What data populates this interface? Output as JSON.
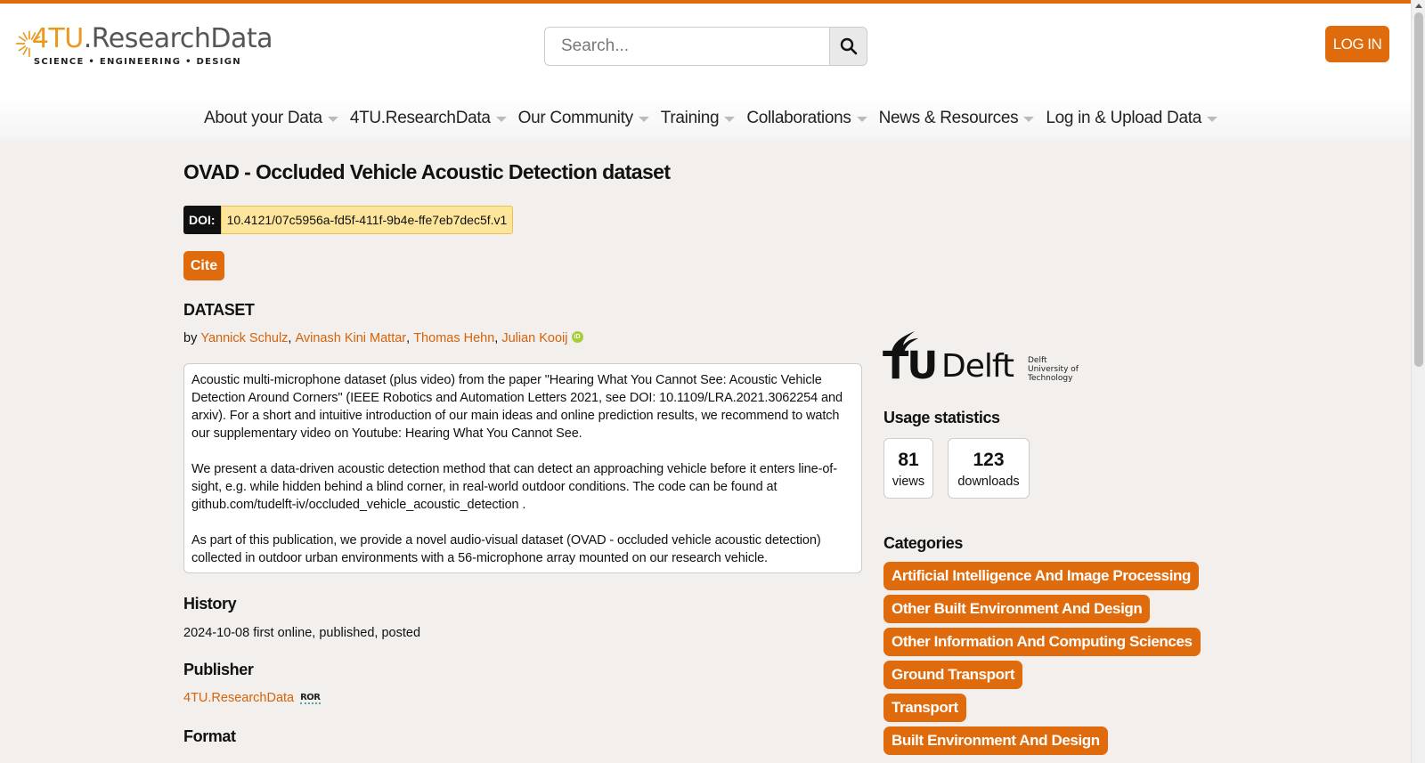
{
  "header": {
    "logo": {
      "main_prefix": "4TU",
      "main_suffix": ".ResearchData",
      "sub": "SCIENCE • ENGINEERING • DESIGN"
    },
    "search": {
      "placeholder": "Search..."
    },
    "login_label": "LOG IN",
    "accent_color": "#e06b0c"
  },
  "nav": {
    "items": [
      {
        "label": "About your Data"
      },
      {
        "label": "4TU.ResearchData"
      },
      {
        "label": "Our Community"
      },
      {
        "label": "Training"
      },
      {
        "label": "Collaborations"
      },
      {
        "label": "News & Resources"
      },
      {
        "label": "Log in & Upload Data"
      }
    ]
  },
  "dataset": {
    "title": "OVAD - Occluded Vehicle Acoustic Detection dataset",
    "doi_label": "DOI:",
    "doi": "10.4121/07c5956a-fd5f-411f-9b4e-ffe7eb7dec5f.v1",
    "cite_label": "Cite",
    "type_label": "DATASET",
    "by": "by",
    "authors": [
      "Yannick Schulz",
      "Avinash Kini Mattar",
      "Thomas Hehn",
      "Julian Kooij"
    ],
    "orcid_icon": "iD",
    "description": [
      "Acoustic multi-microphone dataset (plus video) from the paper \"Hearing What You Cannot See: Acoustic Vehicle Detection Around Corners\" (IEEE Robotics and Automation Letters 2021, see DOI: 10.1109/LRA.2021.3062254 and arxiv). For a short and intuitive introduction of our main ideas and online prediction results, we recommend to watch our supplementary video on Youtube: Hearing What You Cannot See.",
      "We present a data-driven acoustic detection method that can detect an approaching vehicle before it enters line-of-sight, e.g. while hidden behind a blind corner, in real-world outdoor conditions. The code can be found at github.com/tudelft-iv/occluded_vehicle_acoustic_detection .",
      "As part of this publication, we provide a novel audio-visual dataset (OVAD - occluded vehicle acoustic detection) collected in outdoor urban environments with a 56-microphone array mounted on our research vehicle."
    ],
    "history_label": "History",
    "history_text": "2024-10-08 first online, published, posted",
    "publisher_label": "Publisher",
    "publisher": "4TU.ResearchData",
    "ror_label": "ROR",
    "format_label": "Format"
  },
  "sidebar": {
    "institution_logo": {
      "tu": "TU",
      "delft": "Delft",
      "small": [
        "Delft",
        "University of",
        "Technology"
      ]
    },
    "usage_label": "Usage statistics",
    "views_count": "81",
    "views_label": "views",
    "downloads_count": "123",
    "downloads_label": "downloads",
    "categories_label": "Categories",
    "categories": [
      "Artificial Intelligence And Image Processing",
      "Other Built Environment And Design",
      "Other Information And Computing Sciences",
      "Ground Transport",
      "Transport",
      "Built Environment And Design"
    ]
  }
}
